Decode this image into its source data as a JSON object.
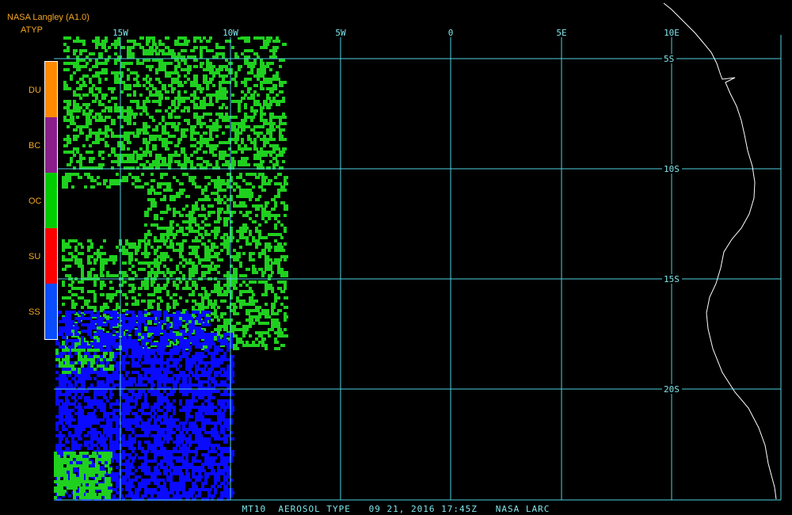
{
  "header": {
    "source": "NASA Langley (A1.0)",
    "product": "ATYP"
  },
  "legend": [
    {
      "code": "DU",
      "color": "#ff8a00"
    },
    {
      "code": "BC",
      "color": "#8a1f8c"
    },
    {
      "code": "OC",
      "color": "#00cc00"
    },
    {
      "code": "SU",
      "color": "#ff0000"
    },
    {
      "code": "SS",
      "color": "#0a4dff"
    }
  ],
  "map": {
    "lon_labels": [
      "15W",
      "10W",
      "5W",
      "0",
      "5E",
      "10E"
    ],
    "lat_labels": [
      "5S",
      "10S",
      "15S",
      "20S"
    ],
    "colors": {
      "grid": "#4fd0e0",
      "aerosol_oc": "#1fd01f",
      "aerosol_ss": "#0a0aff",
      "coast": "#ffffff"
    }
  },
  "footer": {
    "text": "MT10  AEROSOL TYPE   09 21, 2016 17:45Z   NASA LARC"
  }
}
